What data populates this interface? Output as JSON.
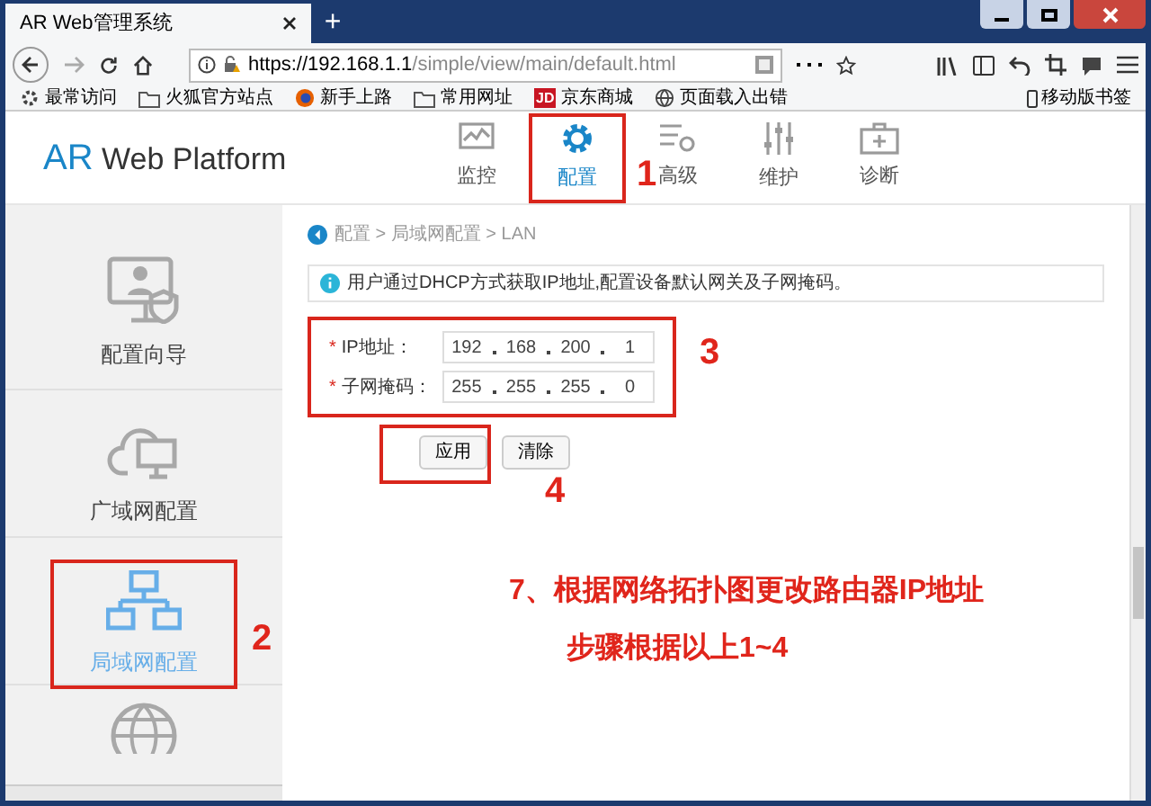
{
  "browser": {
    "tab_title": "AR Web管理系统",
    "new_tab": "+",
    "url_host": "https://192.168.1.1",
    "url_path": "/simple/view/main/default.html",
    "bookmarks": [
      {
        "label": "最常访问",
        "kind": "gear"
      },
      {
        "label": "火狐官方站点",
        "kind": "folder"
      },
      {
        "label": "新手上路",
        "kind": "firefox"
      },
      {
        "label": "常用网址",
        "kind": "folder"
      },
      {
        "label": "京东商城",
        "kind": "jd",
        "logo": "JD"
      },
      {
        "label": "页面载入出错",
        "kind": "globe"
      }
    ],
    "mobile_bookmarks": "移动版书签"
  },
  "app": {
    "logo_brand": "AR",
    "logo_rest": "Web Platform",
    "nav": [
      {
        "label": "监控",
        "kind": "monitor",
        "selected": false,
        "highlighted": false
      },
      {
        "label": "配置",
        "kind": "gear",
        "selected": true,
        "highlighted": true,
        "callout": "1"
      },
      {
        "label": "高级",
        "kind": "advanced",
        "selected": false,
        "highlighted": false
      },
      {
        "label": "维护",
        "kind": "sliders",
        "selected": false,
        "highlighted": false
      },
      {
        "label": "诊断",
        "kind": "kit",
        "selected": false,
        "highlighted": false
      }
    ],
    "sidebar": [
      {
        "label": "配置向导",
        "kind": "wizard",
        "selected": false,
        "highlighted": false
      },
      {
        "label": "广域网配置",
        "kind": "cloud",
        "selected": false,
        "highlighted": false
      },
      {
        "label": "局域网配置",
        "kind": "lan",
        "selected": true,
        "highlighted": true,
        "callout": "2"
      }
    ],
    "breadcrumb": "配置 > 局域网配置 > LAN",
    "info": "用户通过DHCP方式获取IP地址,配置设备默认网关及子网掩码。",
    "form": {
      "highlighted": true,
      "callout": "3",
      "fields": [
        {
          "required_mark": "*",
          "label": "IP地址：",
          "octets": [
            "192",
            "168",
            "200",
            "1"
          ]
        },
        {
          "required_mark": "*",
          "label": "子网掩码：",
          "octets": [
            "255",
            "255",
            "255",
            "0"
          ]
        }
      ]
    },
    "buttons": [
      {
        "label": "应用",
        "highlighted": true,
        "callout": "4"
      },
      {
        "label": "清除",
        "highlighted": false
      }
    ],
    "note": [
      "7、根据网络拓扑图更改路由器IP地址",
      "步骤根据以上1~4"
    ]
  }
}
